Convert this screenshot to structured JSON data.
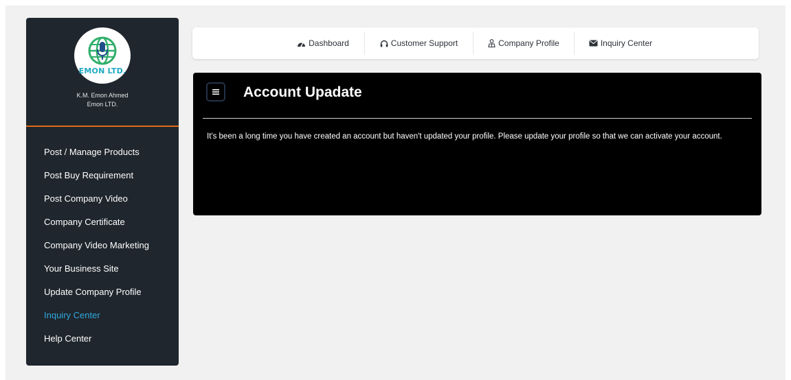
{
  "brand": {
    "logo_text": "EMON LTD.",
    "user_name": "K.M. Emon Ahmed",
    "company_name": "Emon LTD.",
    "accent_color": "#e26a17",
    "logo_color": "#21a9c4"
  },
  "sidebar": {
    "items": [
      {
        "label": "Post / Manage Products",
        "active": false
      },
      {
        "label": "Post Buy Requirement",
        "active": false
      },
      {
        "label": "Post Company Video",
        "active": false
      },
      {
        "label": "Company Certificate",
        "active": false
      },
      {
        "label": "Company Video Marketing",
        "active": false
      },
      {
        "label": "Your Business Site",
        "active": false
      },
      {
        "label": "Update Company Profile",
        "active": false
      },
      {
        "label": "Inquiry Center",
        "active": true
      },
      {
        "label": "Help Center",
        "active": false
      }
    ],
    "active_color": "#2fa8dd"
  },
  "topnav": {
    "items": [
      {
        "label": "Dashboard",
        "icon": "dashboard-icon"
      },
      {
        "label": "Customer Support",
        "icon": "headphones-icon"
      },
      {
        "label": "Company Profile",
        "icon": "user-icon"
      },
      {
        "label": "Inquiry Center",
        "icon": "envelope-icon"
      }
    ]
  },
  "main": {
    "menu_icon": "hamburger-icon",
    "title": "Account Upadate",
    "message": "It's been a long time you have created an account but haven't updated your profile. Please update your profile so that we can activate your account."
  }
}
